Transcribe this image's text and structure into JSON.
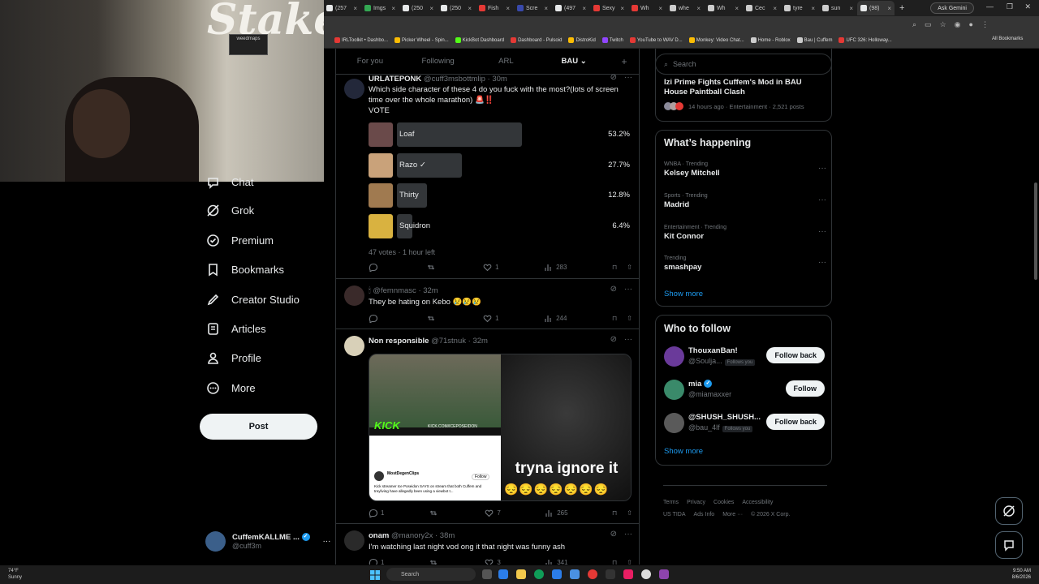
{
  "browser": {
    "tabs": [
      {
        "label": "(257",
        "color": "#e7e9ea"
      },
      {
        "label": "Imgs",
        "color": "#34a853"
      },
      {
        "label": "(250",
        "color": "#e7e9ea"
      },
      {
        "label": "(250",
        "color": "#e7e9ea"
      },
      {
        "label": "Fish",
        "color": "#e53935"
      },
      {
        "label": "Scre",
        "color": "#3949ab"
      },
      {
        "label": "(497",
        "color": "#e7e9ea"
      },
      {
        "label": "Sexy",
        "color": "#e53935"
      },
      {
        "label": "Wh",
        "color": "#e53935"
      },
      {
        "label": "whe",
        "color": "#cccccc"
      },
      {
        "label": "Wh",
        "color": "#cccccc"
      },
      {
        "label": "Cec",
        "color": "#cccccc"
      },
      {
        "label": "tyre",
        "color": "#cccccc"
      },
      {
        "label": "sun",
        "color": "#cccccc"
      },
      {
        "label": "(98)",
        "color": "#e7e9ea",
        "active": true
      }
    ],
    "ask_gemini": "Ask Gemini",
    "bookmarks": [
      {
        "label": "IRLToolkit • Dashbo...",
        "color": "#e53935"
      },
      {
        "label": "Picker Wheel - Spin...",
        "color": "#fbbc04"
      },
      {
        "label": "KickBot Dashboard",
        "color": "#53fc18"
      },
      {
        "label": "Dashboard - Pulsoid",
        "color": "#e53935"
      },
      {
        "label": "DistroKid",
        "color": "#fbbc04"
      },
      {
        "label": "Twitch",
        "color": "#9146ff"
      },
      {
        "label": "YouTube to WAV D...",
        "color": "#e53935"
      },
      {
        "label": "Monkey: Video Chat...",
        "color": "#fbbc04"
      },
      {
        "label": "Home - Roblox",
        "color": "#cccccc"
      },
      {
        "label": "Bau | Cuffem",
        "color": "#cccccc"
      },
      {
        "label": "UFC 326: Holloway...",
        "color": "#e53935"
      }
    ],
    "all_bookmarks": "All Bookmarks"
  },
  "webcam": {
    "logo": "Stake",
    "sign": "weedmaps"
  },
  "nav": {
    "items": [
      {
        "label": "Chat",
        "icon": "chat-icon"
      },
      {
        "label": "Grok",
        "icon": "grok-icon"
      },
      {
        "label": "Premium",
        "icon": "premium-icon"
      },
      {
        "label": "Bookmarks",
        "icon": "bookmark-icon"
      },
      {
        "label": "Creator Studio",
        "icon": "rocket-icon"
      },
      {
        "label": "Articles",
        "icon": "articles-icon"
      },
      {
        "label": "Profile",
        "icon": "profile-icon"
      },
      {
        "label": "More",
        "icon": "more-icon"
      }
    ],
    "post_label": "Post",
    "account": {
      "name": "CuffemKALLME ...",
      "handle": "@cuff3m"
    }
  },
  "timeline": {
    "tabs": [
      "For you",
      "Following",
      "ARL",
      "BAU"
    ],
    "active_tab": "BAU",
    "tweets": [
      {
        "name": "URLATEPONK",
        "handle": "@cuff3msbottmlip · 30m",
        "text": "Which side character of these 4 do you fuck with the most?(lots of screen time over the whole marathon) 🚨‼️",
        "subtext": "VOTE",
        "poll": [
          {
            "label": "Loaf",
            "pct": "53.2%",
            "value": 53.2,
            "thumb": "#6a4a4a"
          },
          {
            "label": "Razo ✓",
            "pct": "27.7%",
            "value": 27.7,
            "thumb": "#c9a27a"
          },
          {
            "label": "Thirty",
            "pct": "12.8%",
            "value": 12.8,
            "thumb": "#a07a50"
          },
          {
            "label": "Squidron",
            "pct": "6.4%",
            "value": 6.4,
            "thumb": "#d9b240"
          }
        ],
        "poll_meta": "47 votes · 1 hour left",
        "replies": "",
        "reposts": "",
        "likes": "1",
        "views": "283"
      },
      {
        "name": "🕯 @femnmasc · 32m",
        "handle": "",
        "text": "They be hating on Kebo 😢😢😢",
        "replies": "",
        "reposts": "",
        "likes": "1",
        "views": "244"
      },
      {
        "name": "Non responsible",
        "handle": "@71stnuk · 32m",
        "text": "",
        "media": {
          "kick_label": "KICK",
          "kick_url": "KICK.COM/ICEPOSEIDON",
          "caption": "tryna ignore it",
          "embed_name": "MostDegenClips",
          "embed_follow": "Follow",
          "embed_text": "Kick streamer Ice Poseidon SAYS on stream that both Cuffem and treyliving have allegedly been using a viewbot t..."
        },
        "replies": "1",
        "reposts": "",
        "likes": "7",
        "views": "265"
      },
      {
        "name": "onam",
        "handle": "@manory2x · 38m",
        "text": "I'm watching last night vod ong it that night was funny ash",
        "replies": "1",
        "reposts": "",
        "likes": "3",
        "views": "341"
      }
    ]
  },
  "sidebar": {
    "search_placeholder": "Search",
    "event": {
      "title": "Izi Prime Fights Cuffem's Mod in BAU House Paintball Clash",
      "meta": "14 hours ago · Entertainment · 2,521 posts"
    },
    "happening": {
      "title": "What’s happening",
      "trends": [
        {
          "meta": "WNBA · Trending",
          "name": "Kelsey Mitchell"
        },
        {
          "meta": "Sports · Trending",
          "name": "Madrid"
        },
        {
          "meta": "Entertainment · Trending",
          "name": "Kit Connor"
        },
        {
          "meta": "Trending",
          "name": "smashpay"
        }
      ],
      "show_more": "Show more"
    },
    "who_to_follow": {
      "title": "Who to follow",
      "accounts": [
        {
          "name": "ThouxanBan!",
          "handle": "@Soulja...",
          "follows_you": "Follows you",
          "button": "Follow back",
          "color": "#6a3a9a"
        },
        {
          "name": "mia",
          "handle": "@miamaxxer",
          "follows_you": "",
          "button": "Follow",
          "color": "#3a8a6a"
        },
        {
          "name": "@SHUSH_SHUSH...",
          "handle": "@bau_4lf",
          "follows_you": "Follows you",
          "button": "Follow back",
          "color": "#5a5a5a"
        }
      ],
      "show_more": "Show more"
    },
    "footer": [
      "Terms",
      "Privacy",
      "Cookies",
      "Accessibility",
      "US TIDA",
      "Ads Info",
      "More ···",
      "© 2026 X Corp."
    ]
  },
  "taskbar": {
    "weather_temp": "74°F",
    "weather_desc": "Sunny",
    "search_label": "Search",
    "time": "9:50 AM",
    "date": "8/6/2026"
  }
}
